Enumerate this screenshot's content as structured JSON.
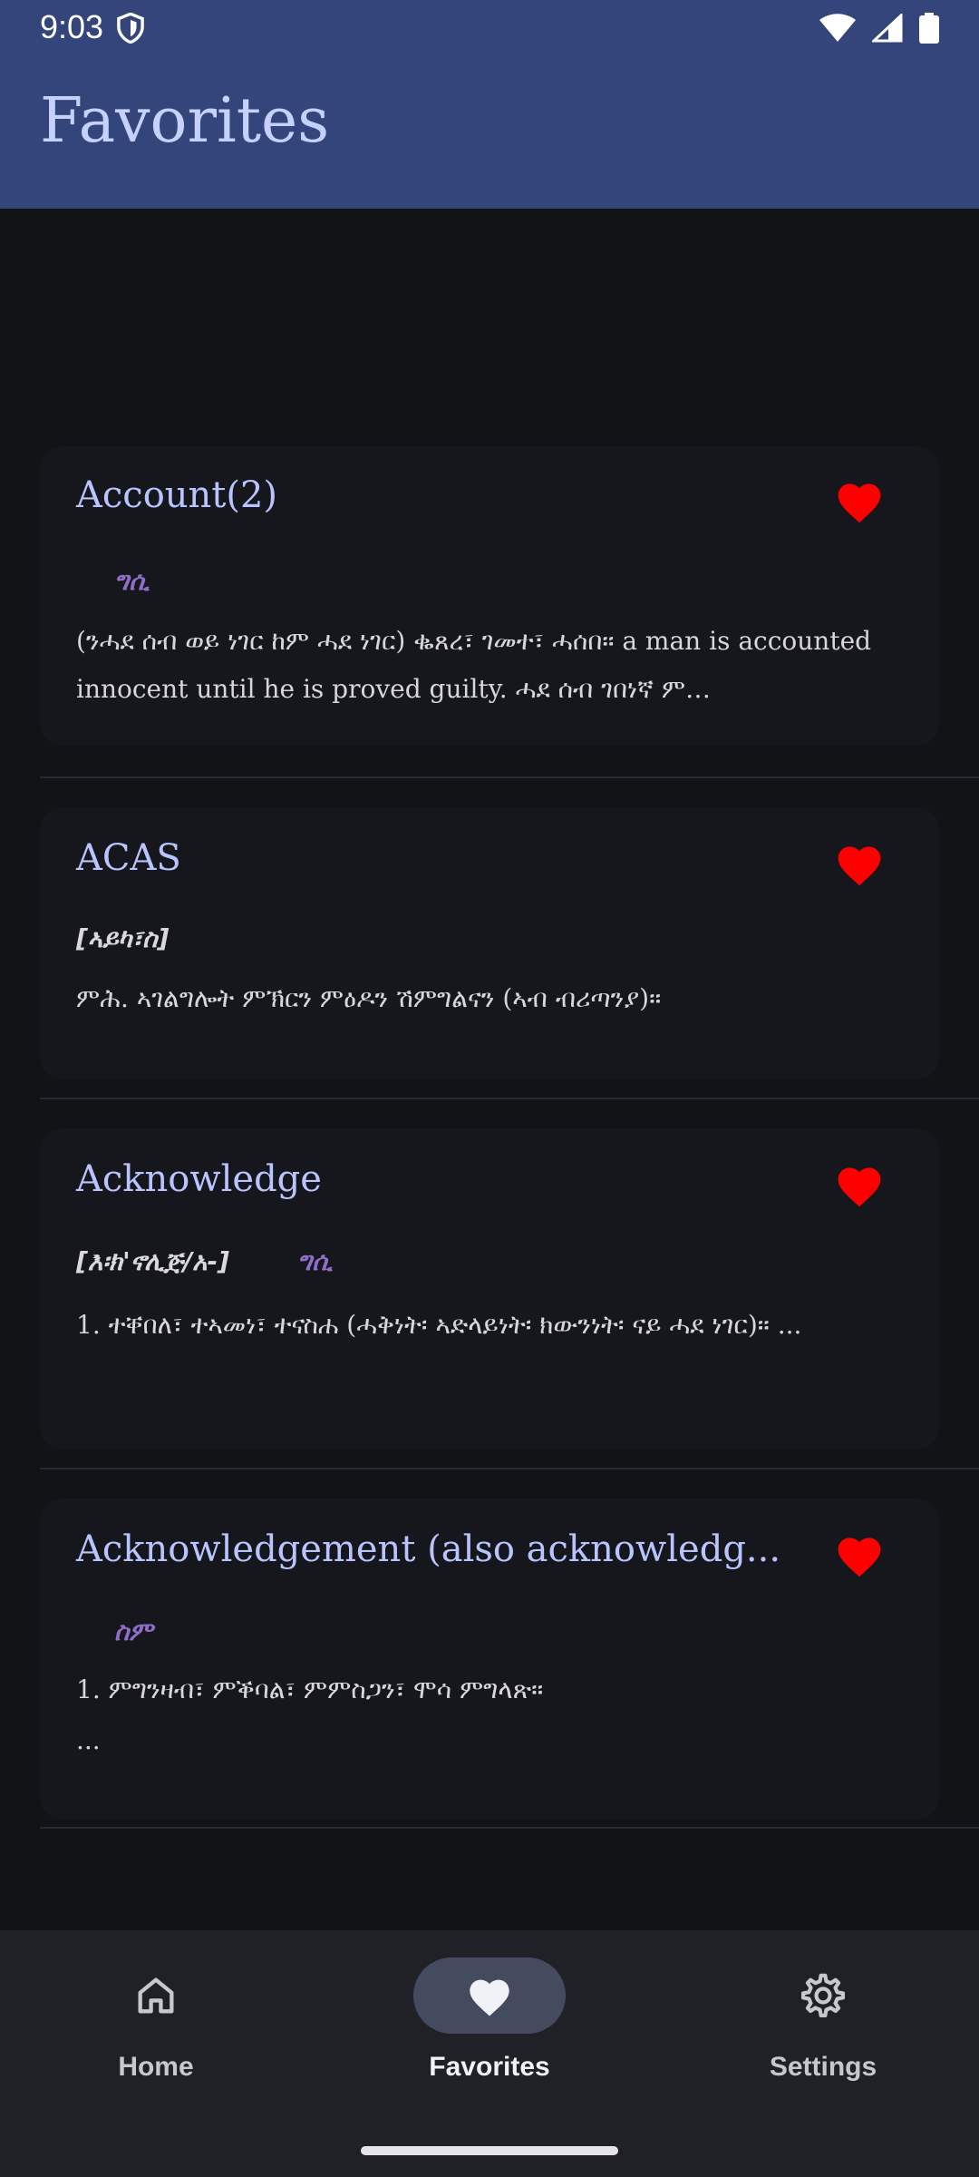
{
  "status_bar": {
    "time": "9:03",
    "icons": [
      "shield-icon",
      "wifi-icon",
      "cell-signal-icon",
      "battery-icon"
    ]
  },
  "app_bar": {
    "title": "Favorites"
  },
  "entries": [
    {
      "word": "Account(2)",
      "pronunciation": "",
      "pos": "ግሲ",
      "definition": "(ንሓደ ሰብ ወይ ነገር ከም ሓደ ነገር) ቈጸረ፣ ገመተ፣ ሓሰበ። a man is accounted innocent until he is proved guilty. ሓደ ሰብ ገበነኛ ም…"
    },
    {
      "word": "ACAS",
      "pronunciation": "[ኣይካ፣ስ]",
      "pos": "",
      "definition": "ምሕ. ኣገልግሎት ምኽርን ምዕዶን ሽምግልናን (ኣብ ብሪጣንያ)።"
    },
    {
      "word": "Acknowledge",
      "pronunciation": "[እ፡ክ'ኖሊጅ/አ-]",
      "pos": "ግሲ",
      "definition": "1. ተቐበለ፣ ተኣመነ፣ ተናስሐ (ሓቅነት፡ ኣድላይነት፡ ክውንነት፡ ናይ ሓደ ነገር)። ..."
    },
    {
      "word": "Acknowledgement (also acknowledg...",
      "pronunciation": "",
      "pos": "ስም",
      "definition": "1. ምግንዛብ፣ ምቕባል፣ ምምስጋን፣ ሞሳ ምግላጽ።",
      "definition_extra": "..."
    }
  ],
  "bottom_nav": {
    "items": [
      {
        "label": "Home",
        "icon": "home-icon",
        "active": false
      },
      {
        "label": "Favorites",
        "icon": "heart-icon",
        "active": true
      },
      {
        "label": "Settings",
        "icon": "gear-icon",
        "active": false
      }
    ]
  },
  "colors": {
    "app_bar": "#33457a",
    "background": "#121317",
    "heart": "#ff0000",
    "word": "#b9c4ff",
    "pos": "#8f6ec9"
  }
}
